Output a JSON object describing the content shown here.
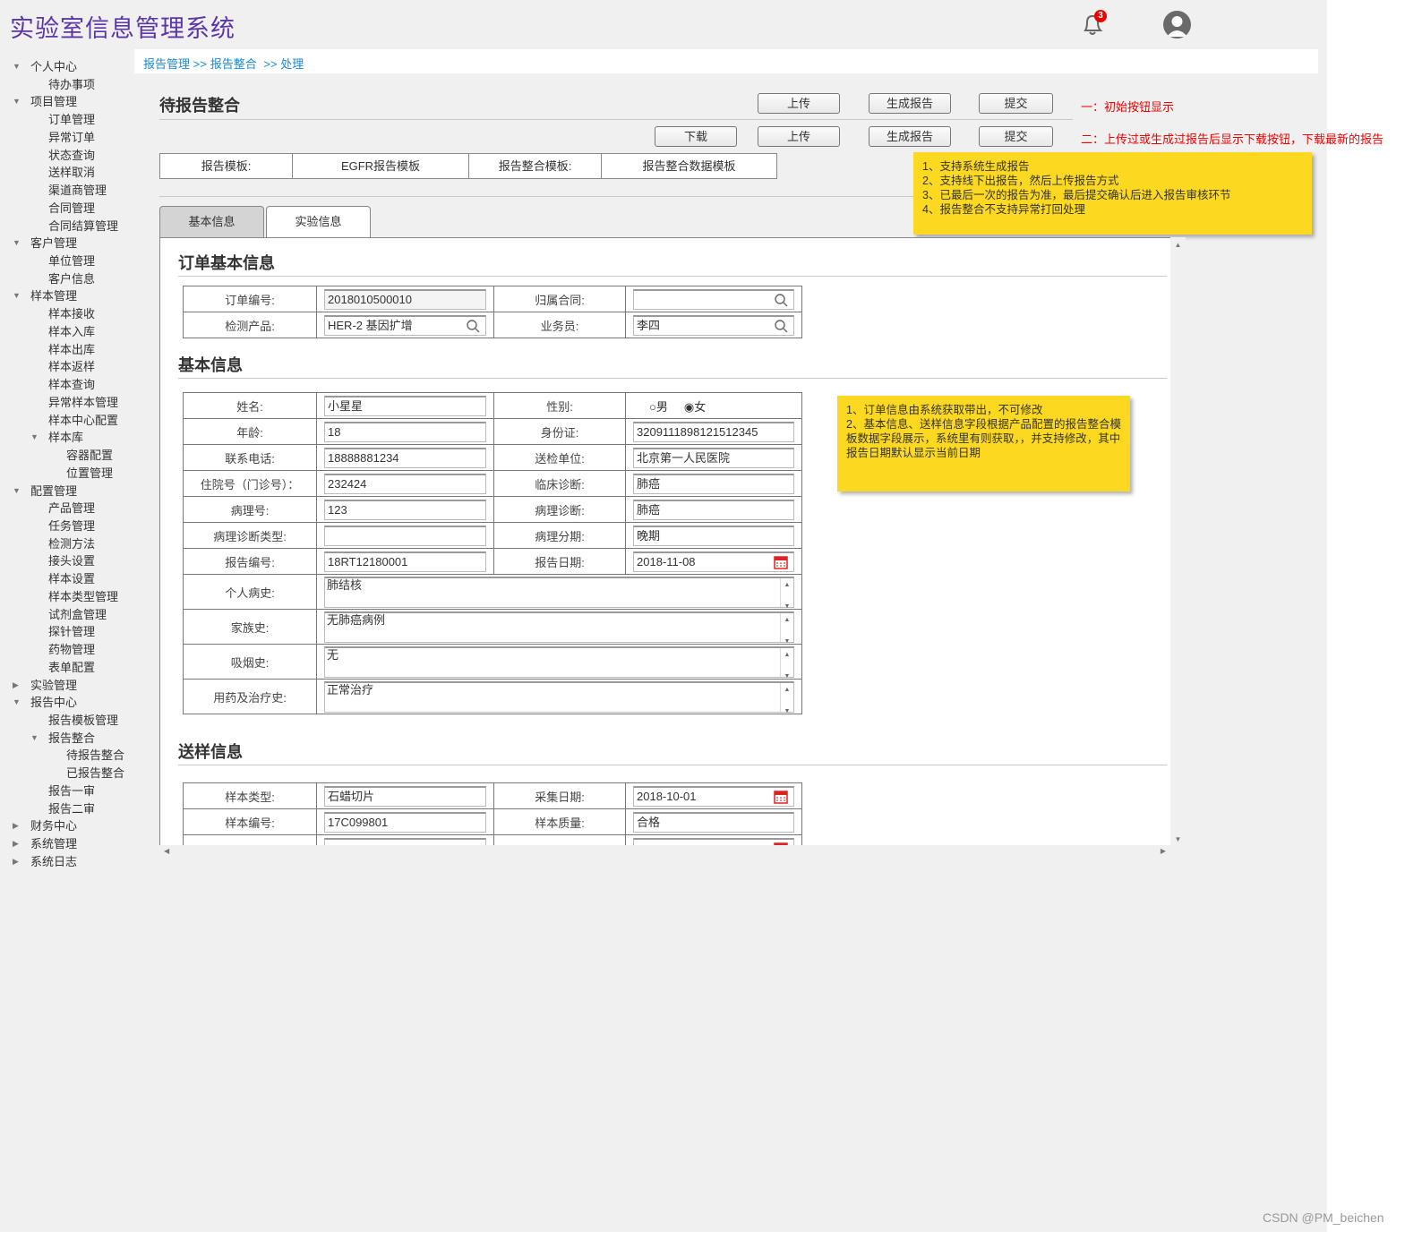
{
  "app": {
    "title": "实验室信息管理系统",
    "notification_count": "3",
    "accent": "#5b36a8"
  },
  "breadcrumb": [
    "报告管理 >>",
    "报告整合",
    " >> 处理"
  ],
  "sidebar": [
    {
      "l": 0,
      "label": "个人中心",
      "arrow": "down"
    },
    {
      "l": 1,
      "label": "待办事项"
    },
    {
      "l": 0,
      "label": "项目管理",
      "arrow": "down"
    },
    {
      "l": 1,
      "label": "订单管理"
    },
    {
      "l": 1,
      "label": "异常订单"
    },
    {
      "l": 1,
      "label": "状态查询"
    },
    {
      "l": 1,
      "label": "送样取消"
    },
    {
      "l": 1,
      "label": "渠道商管理"
    },
    {
      "l": 1,
      "label": "合同管理"
    },
    {
      "l": 1,
      "label": "合同结算管理"
    },
    {
      "l": 0,
      "label": "客户管理",
      "arrow": "down"
    },
    {
      "l": 1,
      "label": "单位管理"
    },
    {
      "l": 1,
      "label": "客户信息"
    },
    {
      "l": 0,
      "label": "样本管理",
      "arrow": "down"
    },
    {
      "l": 1,
      "label": "样本接收"
    },
    {
      "l": 1,
      "label": "样本入库"
    },
    {
      "l": 1,
      "label": "样本出库"
    },
    {
      "l": 1,
      "label": "样本返样"
    },
    {
      "l": 1,
      "label": "样本查询"
    },
    {
      "l": 1,
      "label": "异常样本管理"
    },
    {
      "l": 1,
      "label": "样本中心配置"
    },
    {
      "l": 1,
      "label": "样本库",
      "arrow": "down"
    },
    {
      "l": 2,
      "label": "容器配置"
    },
    {
      "l": 2,
      "label": "位置管理"
    },
    {
      "l": 0,
      "label": "配置管理",
      "arrow": "down"
    },
    {
      "l": 1,
      "label": "产品管理"
    },
    {
      "l": 1,
      "label": "任务管理"
    },
    {
      "l": 1,
      "label": "检测方法"
    },
    {
      "l": 1,
      "label": "接头设置"
    },
    {
      "l": 1,
      "label": "样本设置"
    },
    {
      "l": 1,
      "label": "样本类型管理"
    },
    {
      "l": 1,
      "label": "试剂盒管理"
    },
    {
      "l": 1,
      "label": "探针管理"
    },
    {
      "l": 1,
      "label": "药物管理"
    },
    {
      "l": 1,
      "label": "表单配置"
    },
    {
      "l": 0,
      "label": "实验管理",
      "arrow": "right"
    },
    {
      "l": 0,
      "label": "报告中心",
      "arrow": "down"
    },
    {
      "l": 1,
      "label": "报告模板管理"
    },
    {
      "l": 1,
      "label": "报告整合",
      "arrow": "down"
    },
    {
      "l": 2,
      "label": "待报告整合"
    },
    {
      "l": 2,
      "label": "已报告整合"
    },
    {
      "l": 1,
      "label": "报告一审"
    },
    {
      "l": 1,
      "label": "报告二审"
    },
    {
      "l": 0,
      "label": "财务中心",
      "arrow": "right"
    },
    {
      "l": 0,
      "label": "系统管理",
      "arrow": "right"
    },
    {
      "l": 0,
      "label": "系统日志",
      "arrow": "right"
    }
  ],
  "page": {
    "title": "待报告整合",
    "row1_buttons": [
      "上传",
      "生成报告",
      "提交"
    ],
    "row2_buttons": [
      "下载",
      "上传",
      "生成报告",
      "提交"
    ],
    "note_row1": "一：初始按钮显示",
    "note_row2": "二：上传过或生成过报告后显示下载按钮，下载最新的报告",
    "template": [
      "报告模板:",
      "EGFR报告模板",
      "报告整合模板:",
      "报告整合数据模板"
    ],
    "note_top": [
      "1、支持系统生成报告",
      "2、支持线下出报告，然后上传报告方式",
      "3、已最后一次的报告为准，最后提交确认后进入报告审核环节",
      "4、报告整合不支持异常打回处理"
    ],
    "note_form": [
      "1、订单信息由系统获取带出，不可修改",
      "2、基本信息、送样信息字段根据产品配置的报告整合模板数据字段展示，系统里有则获取，，并支持修改，其中报告日期默认显示当前日期"
    ],
    "tabs": [
      {
        "label": "基本信息",
        "active": true
      },
      {
        "label": "实验信息",
        "active": false
      }
    ]
  },
  "order": {
    "heading": "订单基本信息",
    "rows": [
      [
        {
          "label": "订单编号:"
        },
        {
          "value": "2018010500010",
          "type": "readonly"
        },
        {
          "label": "归属合同:"
        },
        {
          "value": "",
          "type": "search"
        }
      ],
      [
        {
          "label": "检测产品:"
        },
        {
          "value": "HER-2 基因扩增",
          "type": "search"
        },
        {
          "label": "业务员:"
        },
        {
          "value": "李四",
          "type": "search"
        }
      ]
    ]
  },
  "basic": {
    "heading": "基本信息",
    "rows": [
      [
        {
          "label": "姓名:"
        },
        {
          "value": "小星星"
        },
        {
          "label": "性别:"
        },
        {
          "type": "radio",
          "options": [
            "男",
            "女"
          ],
          "selected": "女"
        }
      ],
      [
        {
          "label": "年龄:"
        },
        {
          "value": "18"
        },
        {
          "label": "身份证:"
        },
        {
          "value": "3209111898121512345"
        }
      ],
      [
        {
          "label": "联系电话:"
        },
        {
          "value": "18888881234"
        },
        {
          "label": "送检单位:"
        },
        {
          "value": "北京第一人民医院"
        }
      ],
      [
        {
          "label": "住院号（门诊号）："
        },
        {
          "value": "232424"
        },
        {
          "label": "临床诊断:"
        },
        {
          "value": "肺癌"
        }
      ],
      [
        {
          "label": "病理号:"
        },
        {
          "value": "123"
        },
        {
          "label": "病理诊断:"
        },
        {
          "value": "肺癌"
        }
      ],
      [
        {
          "label": "病理诊断类型:"
        },
        {
          "value": ""
        },
        {
          "label": "病理分期:"
        },
        {
          "value": "晚期"
        }
      ],
      [
        {
          "label": "报告编号:"
        },
        {
          "value": "18RT12180001"
        },
        {
          "label": "报告日期:"
        },
        {
          "value": "2018-11-08",
          "type": "date"
        }
      ]
    ],
    "textareas": [
      {
        "label": "个人病史:",
        "value": "肺结核"
      },
      {
        "label": "家族史:",
        "value": "无肺癌病例"
      },
      {
        "label": "吸烟史:",
        "value": "无"
      },
      {
        "label": "用药及治疗史:",
        "value": "正常治疗"
      }
    ]
  },
  "sample": {
    "heading": "送样信息",
    "rows": [
      [
        {
          "label": "样本类型:"
        },
        {
          "value": "石蜡切片"
        },
        {
          "label": "采集日期:"
        },
        {
          "value": "2018-10-01",
          "type": "date"
        }
      ],
      [
        {
          "label": "样本编号:"
        },
        {
          "value": "17C099801"
        },
        {
          "label": "样本质量:"
        },
        {
          "value": "合格"
        }
      ],
      [
        {
          "label": ""
        },
        {
          "value": ""
        },
        {
          "label": ""
        },
        {
          "value": "",
          "type": "date"
        }
      ]
    ]
  },
  "watermark": "CSDN @PM_beichen"
}
